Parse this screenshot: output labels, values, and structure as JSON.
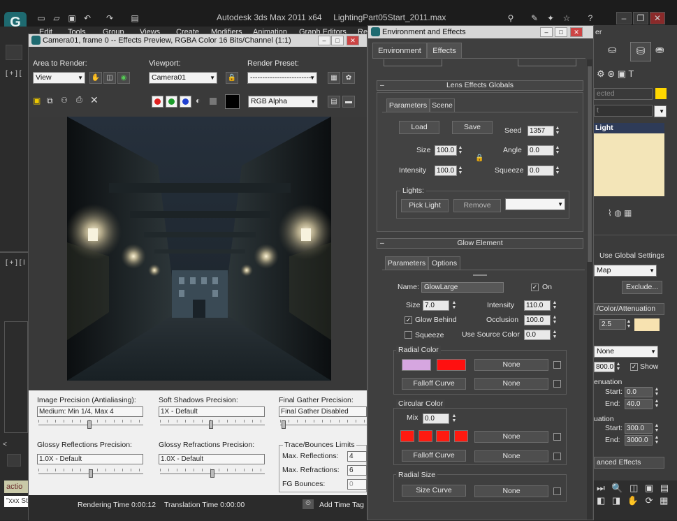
{
  "app": {
    "title": "Autodesk 3ds Max  2011 x64",
    "file": "LightingPart05Start_2011.max",
    "menu": [
      "Edit",
      "Tools",
      "Group",
      "Views",
      "Create",
      "Modifiers",
      "Animation",
      "Graph Editors",
      "Re"
    ]
  },
  "viewport_labels": [
    "[ + ] [",
    "[ + ] [ l"
  ],
  "preview": {
    "title": "Camera01, frame 0 -- Effects Preview, RGBA Color 16 Bits/Channel (1:1)",
    "area_label": "Area to Render:",
    "area_value": "View",
    "viewport_label": "Viewport:",
    "viewport_value": "Camera01",
    "preset_label": "Render Preset:",
    "preset_value": "-------------------------",
    "channel_value": "RGB Alpha",
    "settings": {
      "image_precision_label": "Image Precision (Antialiasing):",
      "image_precision_value": "Medium: Min 1/4, Max 4",
      "soft_shadows_label": "Soft Shadows Precision:",
      "soft_shadows_value": "1X - Default",
      "final_gather_label": "Final Gather Precision:",
      "final_gather_value": "Final Gather Disabled",
      "glossy_refl_label": "Glossy Reflections Precision:",
      "glossy_refl_value": "1.0X - Default",
      "glossy_refr_label": "Glossy Refractions Precision:",
      "glossy_refr_value": "1.0X - Default",
      "trace_label": "Trace/Bounces Limits",
      "max_refl_label": "Max. Reflections:",
      "max_refl_value": "4",
      "max_refr_label": "Max. Refractions:",
      "max_refr_value": "6",
      "fg_bounces_label": "FG Bounces:",
      "fg_bounces_value": "0"
    },
    "status": {
      "rendering_time": "Rendering Time  0:00:12",
      "translation_time": "Translation Time  0:00:00",
      "add_time_tag": "Add Time Tag",
      "script_label": "\"xxx Start\"cor",
      "action_label": "actio"
    }
  },
  "env": {
    "title": "Environment and Effects",
    "tabs": [
      "Environment",
      "Effects"
    ],
    "lens_globals": {
      "header": "Lens Effects Globals",
      "subtabs": [
        "Parameters",
        "Scene"
      ],
      "load": "Load",
      "save": "Save",
      "seed_label": "Seed",
      "seed": "1357",
      "size_label": "Size",
      "size": "100.0",
      "angle_label": "Angle",
      "angle": "0.0",
      "intensity_label": "Intensity",
      "intensity": "100.0",
      "squeeze_label": "Squeeze",
      "squeeze": "0.0",
      "lights_label": "Lights:",
      "pick_light": "Pick Light",
      "remove": "Remove"
    },
    "glow": {
      "header": "Glow Element",
      "subtabs": [
        "Parameters",
        "Options"
      ],
      "name_label": "Name:",
      "name": "GlowLarge",
      "on_label": "On",
      "size_label": "Size",
      "size": "7.0",
      "intensity_label": "Intensity",
      "intensity": "110.0",
      "glow_behind": "Glow Behind",
      "occlusion_label": "Occlusion",
      "occlusion": "100.0",
      "squeeze": "Squeeze",
      "use_source_label": "Use Source Color",
      "use_source": "0.0",
      "radial_color": "Radial Color",
      "none": "None",
      "falloff_curve": "Falloff Curve",
      "circular_color": "Circular Color",
      "mix_label": "Mix",
      "mix": "0.0",
      "radial_size": "Radial Size",
      "size_curve": "Size Curve"
    },
    "colors": {
      "radial1": "#d6a6e0",
      "radial2": "#ff1010",
      "circular": "#ff1a10"
    }
  },
  "right": {
    "name_field": "ected",
    "object_color": "#ffd700",
    "list_item": "Light",
    "list_color": "#f3e5b8",
    "use_global": "Use Global Settings",
    "map_value": "Map",
    "exclude": "Exclude...",
    "attenuation": "/Color/Attenuation",
    "multiplier": "2.5",
    "swatch": "#f7e2b0",
    "decay": "None",
    "decay_start": "800.0",
    "show": "Show",
    "near_atten": "enuation",
    "start_label": "Start:",
    "start1": "0.0",
    "end_label": "End:",
    "end1": "40.0",
    "far_atten": "uation",
    "start2": "300.0",
    "end2": "3000.0",
    "adv_effects": "anced Effects",
    "panel_title": "er"
  }
}
